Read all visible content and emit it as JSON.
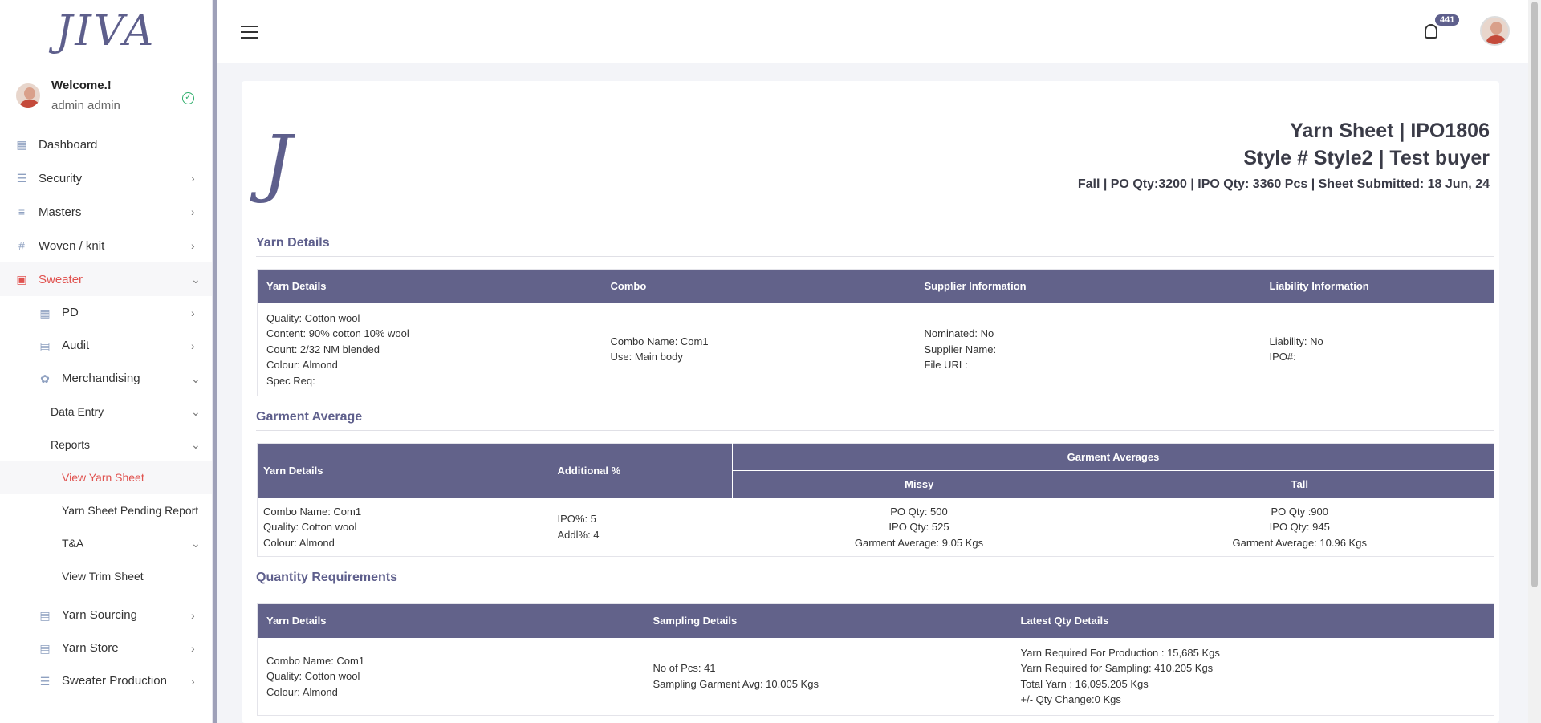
{
  "app": {
    "brand": "JIVA"
  },
  "sidebar": {
    "user": {
      "welcome": "Welcome.!",
      "name": "admin admin"
    },
    "items": [
      {
        "label": "Dashboard"
      },
      {
        "label": "Security"
      },
      {
        "label": "Masters"
      },
      {
        "label": "Woven / knit"
      },
      {
        "label": "Sweater"
      },
      {
        "label": "PD"
      },
      {
        "label": "Audit"
      },
      {
        "label": "Merchandising"
      },
      {
        "label": "Data Entry"
      },
      {
        "label": "Reports"
      },
      {
        "label": "View Yarn Sheet"
      },
      {
        "label": "Yarn Sheet Pending Report"
      },
      {
        "label": "T&A"
      },
      {
        "label": "View Trim Sheet"
      },
      {
        "label": "Yarn Sourcing"
      },
      {
        "label": "Yarn Store"
      },
      {
        "label": "Sweater Production"
      }
    ]
  },
  "topbar": {
    "notification_count": "441"
  },
  "header": {
    "title": "Yarn Sheet | IPO1806",
    "style_line": "Style # Style2 | Test buyer",
    "meta_line": "Fall | PO Qty:3200 | IPO Qty: 3360 Pcs | Sheet Submitted: 18 Jun, 24",
    "logo_letter": "J"
  },
  "yarn_details": {
    "section_title": "Yarn Details",
    "headers": [
      "Yarn Details",
      "Combo",
      "Supplier Information",
      "Liability Information"
    ],
    "col1": [
      "Quality: Cotton wool",
      "Content: 90% cotton 10% wool",
      "Count: 2/32 NM blended",
      "Colour: Almond",
      "Spec Req:"
    ],
    "col2": [
      "Combo Name: Com1",
      "Use: Main body"
    ],
    "col3": [
      "Nominated: No",
      "Supplier Name:",
      "File URL:"
    ],
    "col4": [
      "Liability: No",
      "IPO#:"
    ]
  },
  "garment_average": {
    "section_title": "Garment Average",
    "headers": {
      "yarn": "Yarn Details",
      "additional": "Additional %",
      "group": "Garment Averages",
      "missy": "Missy",
      "tall": "Tall"
    },
    "col1": [
      "Combo Name: Com1",
      "Quality: Cotton wool",
      "Colour: Almond"
    ],
    "col2": [
      "IPO%: 5",
      "Addl%: 4"
    ],
    "missy": [
      "PO Qty: 500",
      "IPO Qty: 525",
      "Garment Average: 9.05 Kgs"
    ],
    "tall": [
      "PO Qty :900",
      "IPO Qty: 945",
      "Garment Average: 10.96 Kgs"
    ]
  },
  "quantity_requirements": {
    "section_title": "Quantity Requirements",
    "headers": [
      "Yarn Details",
      "Sampling Details",
      "Latest Qty Details"
    ],
    "col1": [
      "Combo Name: Com1",
      "Quality: Cotton wool",
      "Colour: Almond"
    ],
    "col2": [
      "No of Pcs: 41",
      "Sampling Garment Avg: 10.005 Kgs"
    ],
    "col3": [
      "Yarn Required For Production : 15,685 Kgs",
      "Yarn Required for Sampling: 410.205 Kgs",
      "Total Yarn : 16,095.205 Kgs",
      "+/- Qty Change:0 Kgs"
    ]
  }
}
